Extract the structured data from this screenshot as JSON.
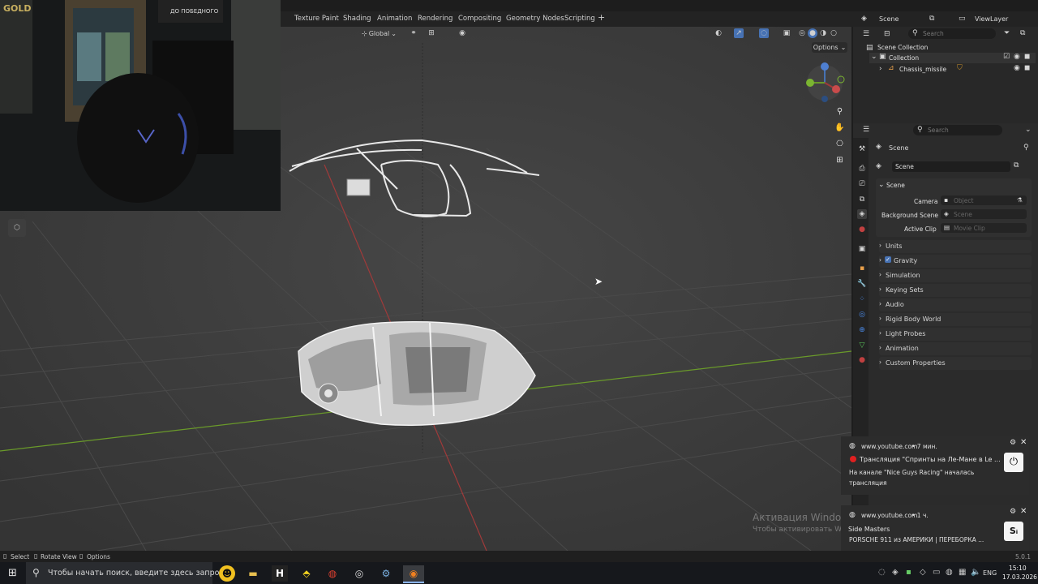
{
  "workspace_tabs": [
    "Texture Paint",
    "Shading",
    "Animation",
    "Rendering",
    "Compositing",
    "Geometry Nodes",
    "Scripting",
    "+"
  ],
  "top_right": {
    "scene_label": "Scene",
    "view_layer_label": "ViewLayer"
  },
  "viewport_header": {
    "orientation": "Global",
    "options": "Options"
  },
  "webcam": {
    "sign_text_1": "GOLD",
    "sign_text_2": "ДО ПОБЕДНОГО"
  },
  "outliner": {
    "search_placeholder": "Search",
    "scene_collection": "Scene Collection",
    "collection": "Collection",
    "object": "Chassis_missile"
  },
  "properties": {
    "search_placeholder": "Search",
    "context_title": "Scene",
    "scene_name": "Scene",
    "panel_title": "Scene",
    "camera_label": "Camera",
    "camera_placeholder": "Object",
    "background_label": "Background Scene",
    "background_placeholder": "Scene",
    "clip_label": "Active Clip",
    "clip_placeholder": "Movie Clip",
    "sections": [
      "Units",
      "Gravity",
      "Simulation",
      "Keying Sets",
      "Audio",
      "Rigid Body World",
      "Light Probes",
      "Animation",
      "Custom Properties"
    ]
  },
  "statusbar": {
    "select": "Select",
    "rotate": "Rotate View",
    "options": "Options",
    "version": "5.0.1"
  },
  "notifications": [
    {
      "source": "www.youtube.com",
      "time": "• 7 мин.",
      "title": "Трансляция \"Спринты на Ле-Мане в Le ...",
      "body": "На канале \"Nice Guys Racing\" началась трансляция"
    },
    {
      "source": "www.youtube.com",
      "time": "• 1 ч.",
      "title": "Side Masters",
      "body": "PORSCHE 911 из АМЕРИКИ | ПЕРЕБОРКА ..."
    }
  ],
  "watermark": {
    "line1": "Активация Windows",
    "line2": "Чтобы активировать Windows, перейдите в раздел \"Параметры\"."
  },
  "taskbar": {
    "search_placeholder": "Чтобы начать поиск, введите здесь запрос",
    "lang": "ENG",
    "time": "15:10",
    "date": "17.03.2026"
  },
  "colors": {
    "accent": "#4772b3",
    "viewport_bg": "#3d3d3d",
    "x_axis": "#a03a3a",
    "y_axis": "#6a9a2a"
  }
}
